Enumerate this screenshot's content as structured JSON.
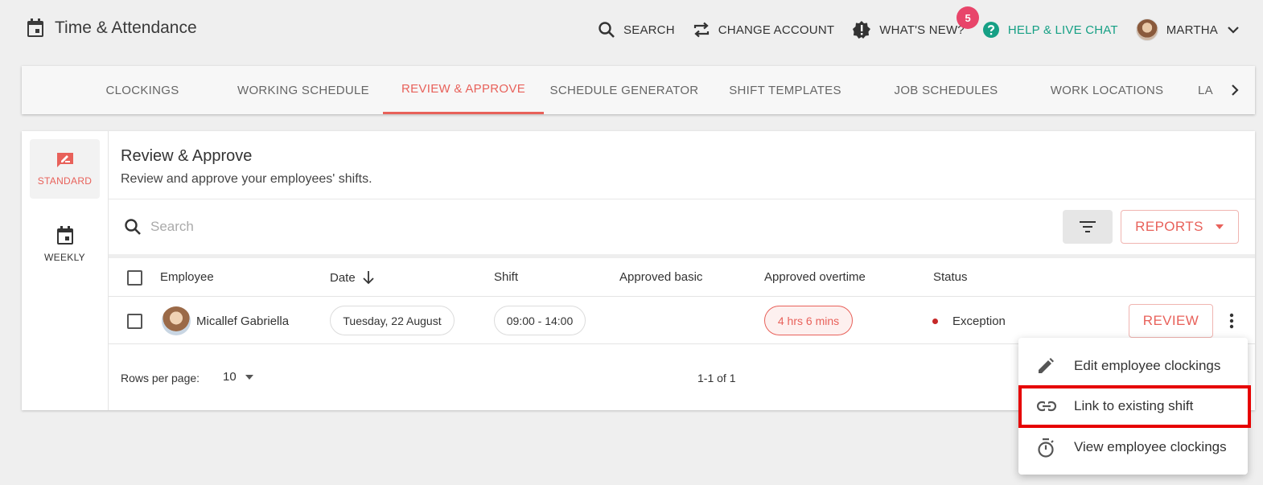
{
  "app": {
    "title": "Time & Attendance",
    "calendar_icon": "calendar-icon"
  },
  "top_actions": {
    "search_label": "SEARCH",
    "change_account_label": "CHANGE ACCOUNT",
    "whats_new_label": "WHAT'S NEW?",
    "whats_new_badge": "5",
    "help_label": "HELP & LIVE CHAT",
    "user_name": "MARTHA",
    "help_color": "#16a085",
    "badge_color": "#e8456a"
  },
  "tabs": [
    {
      "label": "CLOCKINGS"
    },
    {
      "label": "WORKING SCHEDULE"
    },
    {
      "label": "REVIEW & APPROVE"
    },
    {
      "label": "SCHEDULE GENERATOR"
    },
    {
      "label": "SHIFT TEMPLATES"
    },
    {
      "label": "JOB SCHEDULES"
    },
    {
      "label": "WORK LOCATIONS"
    },
    {
      "label": "LA"
    }
  ],
  "active_tab": "REVIEW & APPROVE",
  "accent_color": "#e8615a",
  "sidebar": {
    "items": [
      {
        "label": "STANDARD",
        "icon": "rate-review-icon",
        "active": true
      },
      {
        "label": "WEEKLY",
        "icon": "calendar-icon",
        "active": false
      }
    ]
  },
  "page": {
    "title": "Review & Approve",
    "subtitle": "Review and approve your employees' shifts."
  },
  "search": {
    "placeholder": "Search",
    "value": ""
  },
  "toolbar": {
    "reports_label": "REPORTS"
  },
  "table": {
    "columns": [
      "Employee",
      "Date",
      "Shift",
      "Approved basic",
      "Approved overtime",
      "Status"
    ],
    "rows": [
      {
        "employee": "Micallef Gabriella",
        "date": "Tuesday, 22 August",
        "shift": "09:00 - 14:00",
        "approved_basic": "",
        "approved_overtime": "4 hrs 6 mins",
        "status": "Exception",
        "status_color": "#c62828",
        "action_label": "REVIEW"
      }
    ]
  },
  "pagination": {
    "rows_per_page_label": "Rows per page:",
    "rows_per_page_value": "10",
    "range": "1-1 of 1"
  },
  "context_menu": {
    "items": [
      {
        "label": "Edit employee clockings",
        "icon": "pencil-icon"
      },
      {
        "label": "Link to existing shift",
        "icon": "link-icon",
        "highlighted": true
      },
      {
        "label": "View employee clockings",
        "icon": "timer-icon"
      }
    ],
    "highlight_color": "#e60000"
  }
}
